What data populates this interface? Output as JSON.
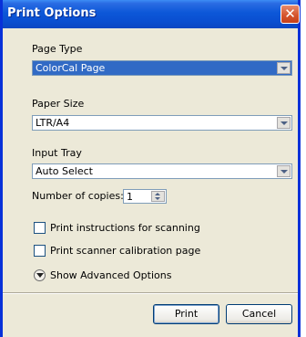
{
  "window": {
    "title": "Print Options"
  },
  "page_type": {
    "label": "Page Type",
    "value": "ColorCal Page"
  },
  "paper_size": {
    "label": "Paper Size",
    "value": "LTR/A4"
  },
  "input_tray": {
    "label": "Input Tray",
    "value": "Auto Select"
  },
  "copies": {
    "label": "Number of copies:",
    "value": "1"
  },
  "options": {
    "print_instructions": {
      "label": "Print instructions for scanning",
      "checked": false
    },
    "print_calibration": {
      "label": "Print scanner calibration page",
      "checked": false
    }
  },
  "advanced": {
    "label": "Show Advanced Options"
  },
  "buttons": {
    "print": "Print",
    "cancel": "Cancel"
  },
  "icons": {
    "close": "close-icon",
    "combo_arrow": "chevron-down-icon",
    "spinner": "spinner-arrows-icon",
    "expand": "expand-down-icon"
  },
  "colors": {
    "titlebar": "#0a4fd1",
    "selection": "#316ac5",
    "dialog_bg": "#ece9d8",
    "close": "#d4532c"
  }
}
